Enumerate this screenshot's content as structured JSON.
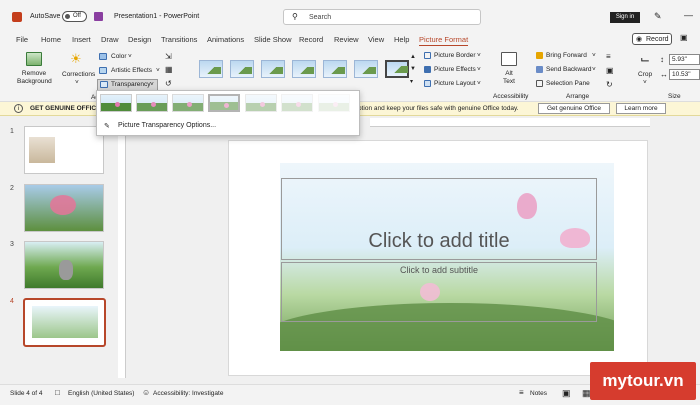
{
  "titlebar": {
    "autosave_label": "AutoSave",
    "autosave_state": "Off",
    "doc_title": "Presentation1 - PowerPoint",
    "search_placeholder": "Search",
    "sign_in": "Sign in"
  },
  "tabs": [
    "File",
    "Home",
    "Insert",
    "Draw",
    "Design",
    "Transitions",
    "Animations",
    "Slide Show",
    "Record",
    "Review",
    "View",
    "Help",
    "Picture Format"
  ],
  "active_tab": "Picture Format",
  "record_button": "Record",
  "ribbon": {
    "remove_background": "Remove Background",
    "corrections": "Corrections",
    "color": "Color",
    "artistic_effects": "Artistic Effects",
    "transparency": "Transparency",
    "picture_border": "Picture Border",
    "picture_effects": "Picture Effects",
    "picture_layout": "Picture Layout",
    "alt_text": "Alt Text",
    "accessibility_group": "Accessibility",
    "bring_forward": "Bring Forward",
    "send_backward": "Send Backward",
    "selection_pane": "Selection Pane",
    "arrange_group": "Arrange",
    "crop": "Crop",
    "height_value": "5.93\"",
    "width_value": "10.53\"",
    "size_group": "Size",
    "adjust_group_partial": "Ad"
  },
  "msgbar": {
    "title": "GET GENUINE OFFICE",
    "text": "ption and keep your files safe with genuine Office today.",
    "btn1": "Get genuine Office",
    "btn2": "Learn more"
  },
  "transparency_menu": {
    "option": "Picture Transparency Options..."
  },
  "slides": [
    "1",
    "2",
    "3",
    "4"
  ],
  "slide": {
    "title_placeholder": "Click to add title",
    "subtitle_placeholder": "Click to add subtitle"
  },
  "status": {
    "slide_info": "Slide 4 of 4",
    "language": "English (United States)",
    "accessibility": "Accessibility: Investigate",
    "notes": "Notes"
  },
  "watermark": "mytour.vn"
}
